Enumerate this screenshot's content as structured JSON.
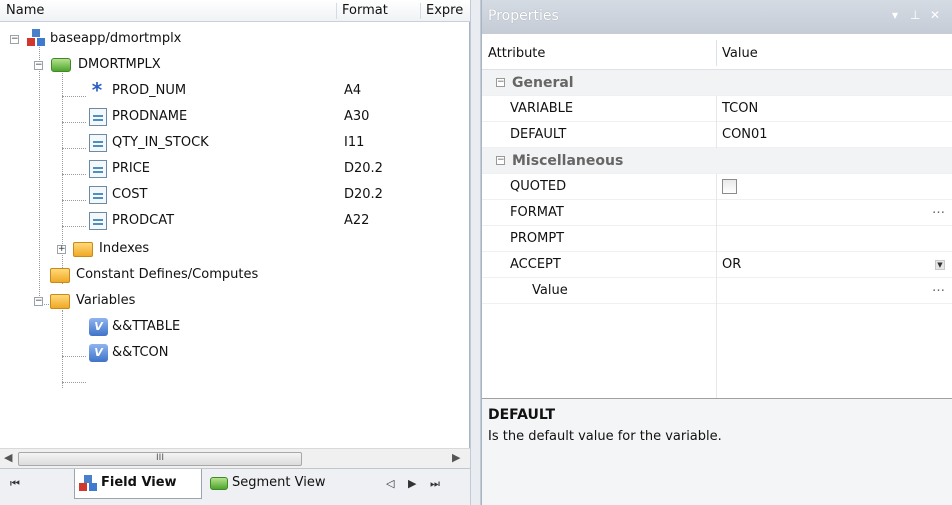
{
  "left_pane": {
    "columns": {
      "name": "Name",
      "format": "Format",
      "expression": "Expre"
    },
    "tree": {
      "root": "baseapp/dmortmplx",
      "segment": "DMORTMPLX",
      "fields": [
        {
          "name": "PROD_NUM",
          "format": "A4",
          "icon": "key-field-icon"
        },
        {
          "name": "PRODNAME",
          "format": "A30",
          "icon": "field-icon"
        },
        {
          "name": "QTY_IN_STOCK",
          "format": "I11",
          "icon": "field-icon"
        },
        {
          "name": "PRICE",
          "format": "D20.2",
          "icon": "field-icon"
        },
        {
          "name": "COST",
          "format": "D20.2",
          "icon": "field-icon"
        },
        {
          "name": "PRODCAT",
          "format": "A22",
          "icon": "field-icon"
        }
      ],
      "indexes": "Indexes",
      "constants": "Constant Defines/Computes",
      "variables": "Variables",
      "variable_items": [
        "&&TTABLE",
        "&&TCON"
      ]
    },
    "scrollbar_grip": "III",
    "tabs": {
      "field_view": "Field View",
      "segment_view": "Segment View"
    }
  },
  "properties": {
    "title": "Properties",
    "controls": {
      "pin": "▾",
      "dock": "⊥",
      "close": "✕"
    },
    "headers": {
      "attribute": "Attribute",
      "value": "Value"
    },
    "categories": {
      "general": "General",
      "misc": "Miscellaneous"
    },
    "rows": {
      "variable": {
        "attr": "VARIABLE",
        "value": "TCON"
      },
      "default": {
        "attr": "DEFAULT",
        "value": "CON01"
      },
      "quoted": {
        "attr": "QUOTED",
        "checked": false
      },
      "format": {
        "attr": "FORMAT",
        "value": ""
      },
      "prompt": {
        "attr": "PROMPT",
        "value": ""
      },
      "accept": {
        "attr": "ACCEPT",
        "value": "OR"
      },
      "value": {
        "attr": "Value",
        "value": ""
      }
    },
    "description": {
      "title": "DEFAULT",
      "text": "Is the default value for the variable."
    }
  }
}
